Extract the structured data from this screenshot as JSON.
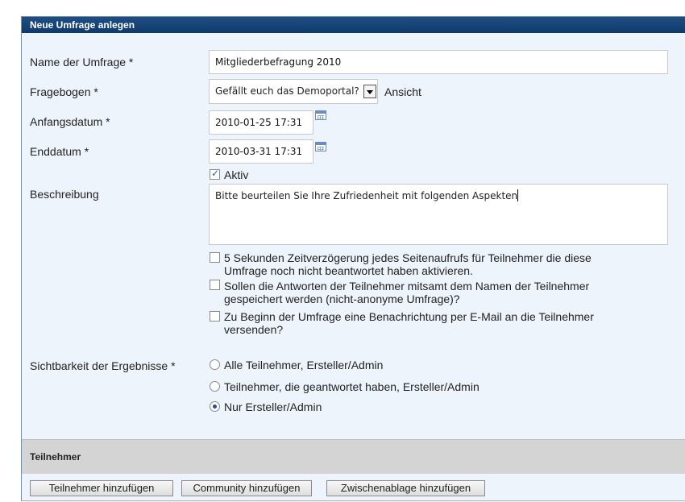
{
  "header": {
    "title": "Neue Umfrage anlegen"
  },
  "form": {
    "name_label": "Name der Umfrage *",
    "name_value": "Mitgliederbefragung 2010",
    "questionnaire_label": "Fragebogen *",
    "questionnaire_value": "Gefällt euch das Demoportal?",
    "view_link": "Ansicht",
    "start_label": "Anfangsdatum *",
    "start_value": "2010-01-25 17:31",
    "end_label": "Enddatum *",
    "end_value": "2010-03-31 17:31",
    "active_label": "Aktiv",
    "active_checked": true,
    "description_label": "Beschreibung",
    "description_value": "Bitte beurteilen Sie Ihre Zufriedenheit mit folgenden Aspekten",
    "options": [
      {
        "text": "5 Sekunden Zeitverzögerung jedes Seitenaufrufs für Teilnehmer die diese Umfrage noch nicht beantwortet haben aktivieren.",
        "checked": false
      },
      {
        "text": "Sollen die Antworten der Teilnehmer mitsamt dem Namen der Teilnehmer gespeichert werden (nicht-anonyme Umfrage)?",
        "checked": false
      },
      {
        "text": "Zu Beginn der Umfrage eine Benachrichtung per E-Mail an die Teilnehmer versenden?",
        "checked": false
      }
    ],
    "visibility_label": "Sichtbarkeit der Ergebnisse *",
    "visibility_options": [
      {
        "text": "Alle Teilnehmer, Ersteller/Admin",
        "selected": false
      },
      {
        "text": "Teilnehmer, die geantwortet haben, Ersteller/Admin",
        "selected": false
      },
      {
        "text": "Nur Ersteller/Admin",
        "selected": true
      }
    ]
  },
  "participants": {
    "title": "Teilnehmer",
    "buttons": [
      "Teilnehmer hinzufügen",
      "Community hinzufügen",
      "Zwischenablage hinzufügen"
    ]
  }
}
